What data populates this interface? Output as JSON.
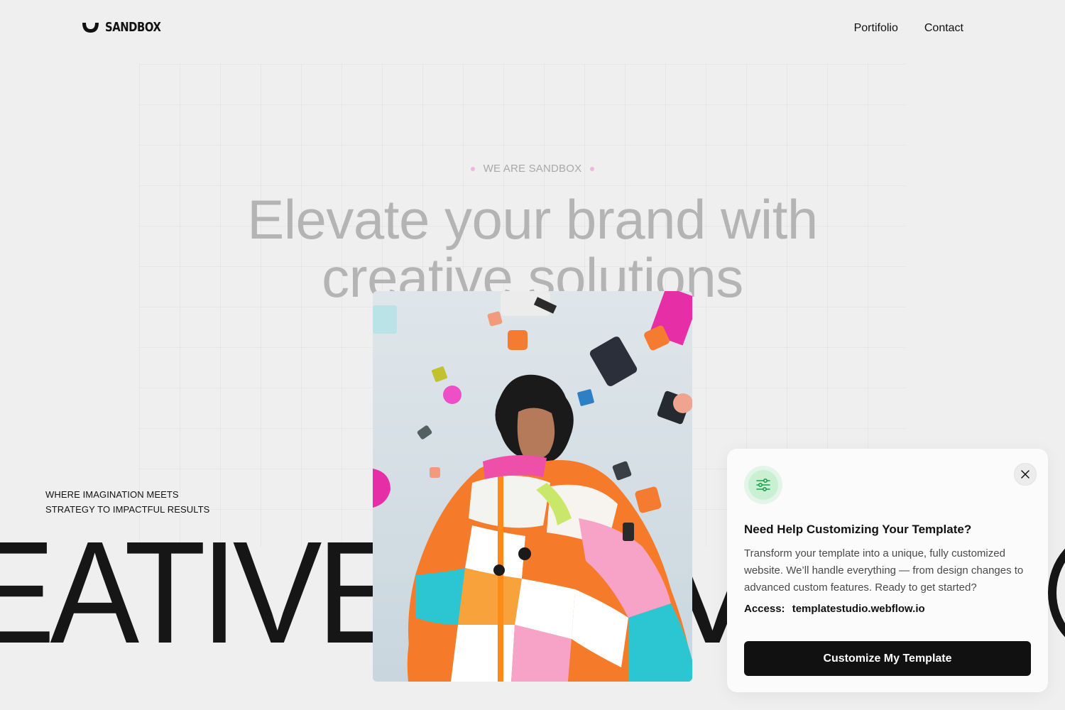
{
  "header": {
    "logo_text": "SANDBOX",
    "nav": [
      {
        "label": "Portifolio"
      },
      {
        "label": "Contact"
      }
    ]
  },
  "hero": {
    "eyebrow": "WE ARE SANDBOX",
    "headline_line1": "Elevate your brand with",
    "headline_line2": "creative solutions",
    "tagline_line1": "WHERE IMAGINATION MEETS",
    "tagline_line2": "STRATEGY TO IMPACTFUL RESULTS",
    "big_word": "EATIVE",
    "big_word_right": "V"
  },
  "popup": {
    "icon": "sliders-icon",
    "title": "Need Help Customizing Your Template?",
    "body": "Transform your template into a unique, fully customized website. We’ll handle everything — from design changes to advanced custom features. Ready to get started?",
    "access_label": "Access:",
    "access_value": "templatestudio.webflow.io",
    "cta_label": "Customize My Template"
  },
  "colors": {
    "background": "#efefef",
    "accent_dot": "#efb7dd",
    "icon_green": "#1f9d4c",
    "cta": "#111111"
  }
}
